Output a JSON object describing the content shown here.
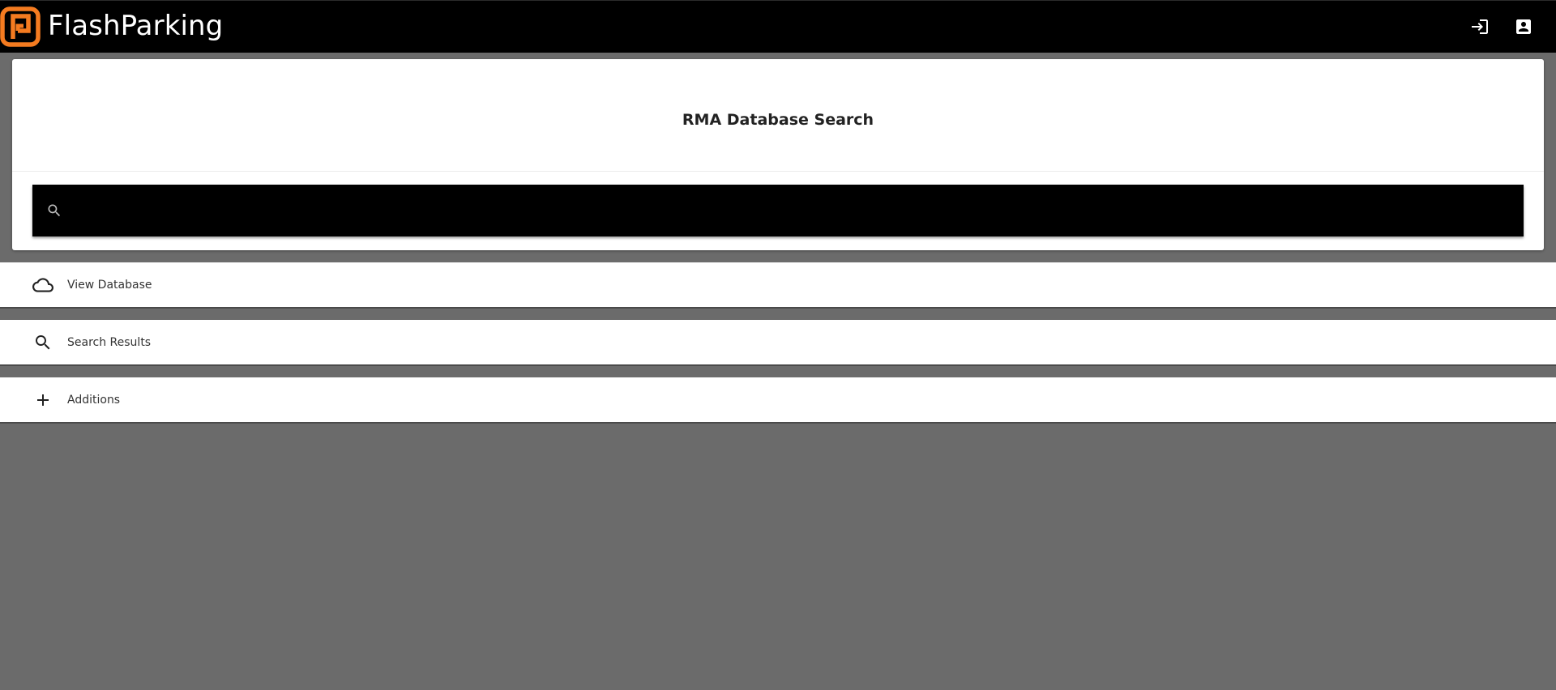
{
  "app": {
    "brand": "FlashParking",
    "brand_color": "#f47b20",
    "topbar_actions": [
      {
        "icon": "login-icon"
      },
      {
        "icon": "account-box-icon"
      }
    ]
  },
  "search_card": {
    "title": "RMA Database Search",
    "search": {
      "value": "",
      "placeholder": "",
      "icon": "search-icon"
    }
  },
  "nav": {
    "items": [
      {
        "label": "View Database",
        "icon": "cloud-icon"
      },
      {
        "label": "Search Results",
        "icon": "search-icon"
      },
      {
        "label": "Additions",
        "icon": "plus-icon"
      }
    ]
  },
  "colors": {
    "topbar": "#000000",
    "page_background": "#6b6b6b",
    "search_bar": "#000000"
  }
}
